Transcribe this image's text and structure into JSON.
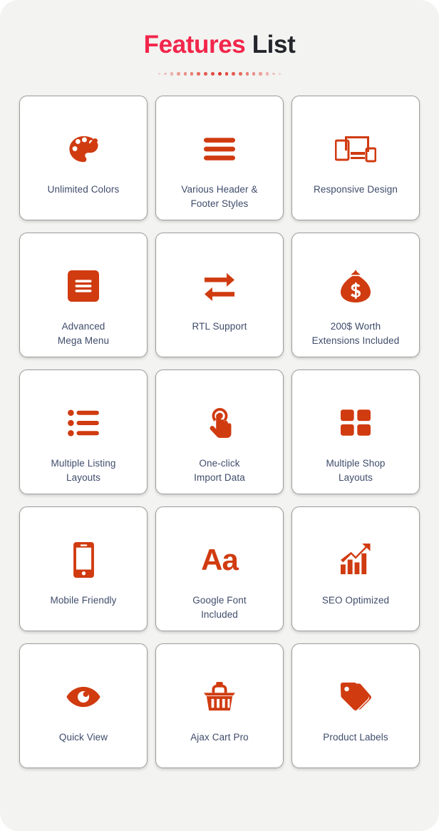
{
  "header": {
    "title_accent": "Features",
    "title_plain": "List",
    "dot_count": 19,
    "accent_color": "#f2264b",
    "dot_color": "#e03a2f"
  },
  "theme": {
    "page_background": "#f3f3f1",
    "card_background": "#ffffff",
    "card_border": "#9d9d9d",
    "icon_color": "#d03b10",
    "label_color": "#3f4c6b"
  },
  "features": [
    {
      "icon": "palette-icon",
      "label": "Unlimited Colors"
    },
    {
      "icon": "bars-icon",
      "label": "Various Header &\nFooter Styles"
    },
    {
      "icon": "responsive-devices-icon",
      "label": "Responsive Design"
    },
    {
      "icon": "menu-square-icon",
      "label": "Advanced\nMega Menu"
    },
    {
      "icon": "exchange-arrows-icon",
      "label": "RTL Support"
    },
    {
      "icon": "money-bag-icon",
      "label": "200$ Worth\nExtensions Included"
    },
    {
      "icon": "list-ul-icon",
      "label": "Multiple Listing\nLayouts"
    },
    {
      "icon": "hand-pointer-click-icon",
      "label": "One-click\nImport Data"
    },
    {
      "icon": "grid-four-squares-icon",
      "label": "Multiple Shop\nLayouts"
    },
    {
      "icon": "mobile-phone-icon",
      "label": "Mobile Friendly"
    },
    {
      "icon": "font-aa-icon",
      "label": "Google Font\nIncluded"
    },
    {
      "icon": "chart-arrow-up-icon",
      "label": "SEO Optimized"
    },
    {
      "icon": "eye-icon",
      "label": "Quick View"
    },
    {
      "icon": "shopping-basket-icon",
      "label": "Ajax Cart Pro"
    },
    {
      "icon": "tags-icon",
      "label": "Product Labels"
    }
  ]
}
